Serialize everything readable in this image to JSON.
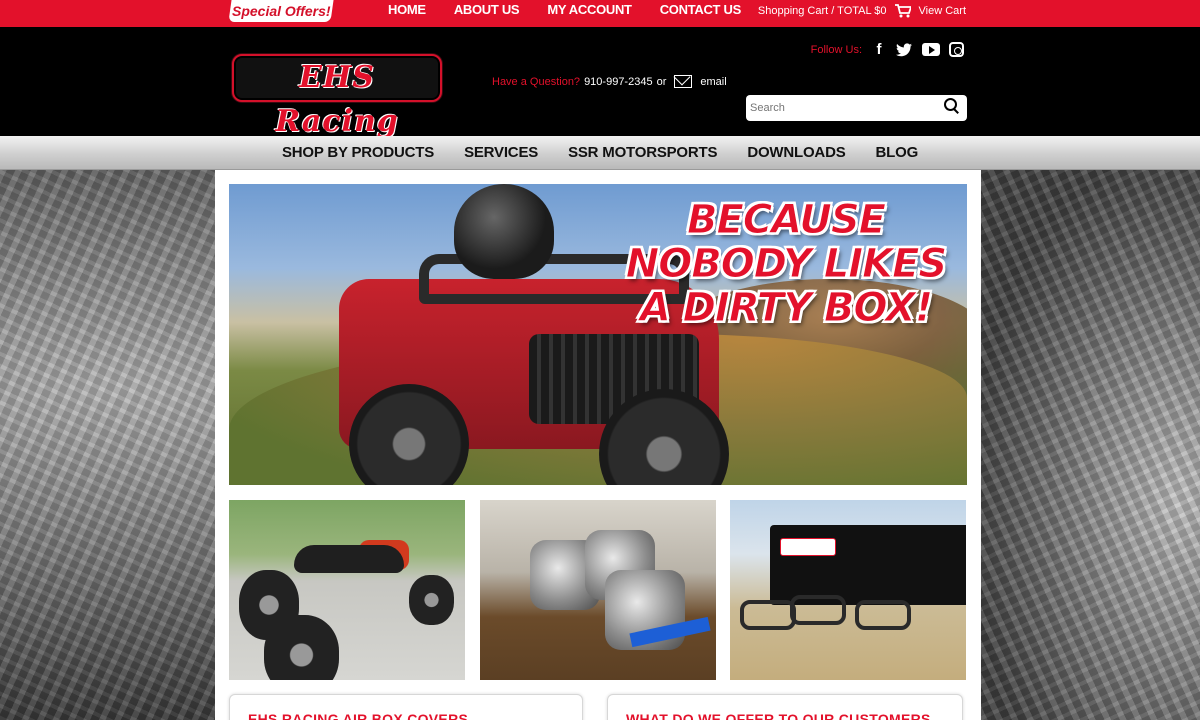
{
  "topbar": {
    "special_offers": "Special Offers!",
    "nav": [
      "HOME",
      "ABOUT US",
      "MY ACCOUNT",
      "CONTACT US"
    ],
    "cart_text": "Shopping Cart / TOTAL $0",
    "view_cart": "View Cart"
  },
  "header": {
    "logo_text": "EHS Racing",
    "question_label": "Have a Question?",
    "phone": "910-997-2345",
    "or": "or",
    "email": "email",
    "follow_label": "Follow Us:",
    "search_placeholder": "Search"
  },
  "mainnav": {
    "items": [
      "SHOP BY PRODUCTS",
      "SERVICES",
      "SSR MOTORSPORTS",
      "DOWNLOADS",
      "BLOG"
    ]
  },
  "hero": {
    "title": "BECAUSE NOBODY LIKES A DIRTY BOX!"
  },
  "cards": [
    {
      "title": "EHS RACING AIR BOX COVERS"
    },
    {
      "title": "WHAT DO WE OFFER TO OUR CUSTOMERS"
    }
  ],
  "colors": {
    "brand_red": "#e3112b",
    "header_black": "#000000"
  }
}
